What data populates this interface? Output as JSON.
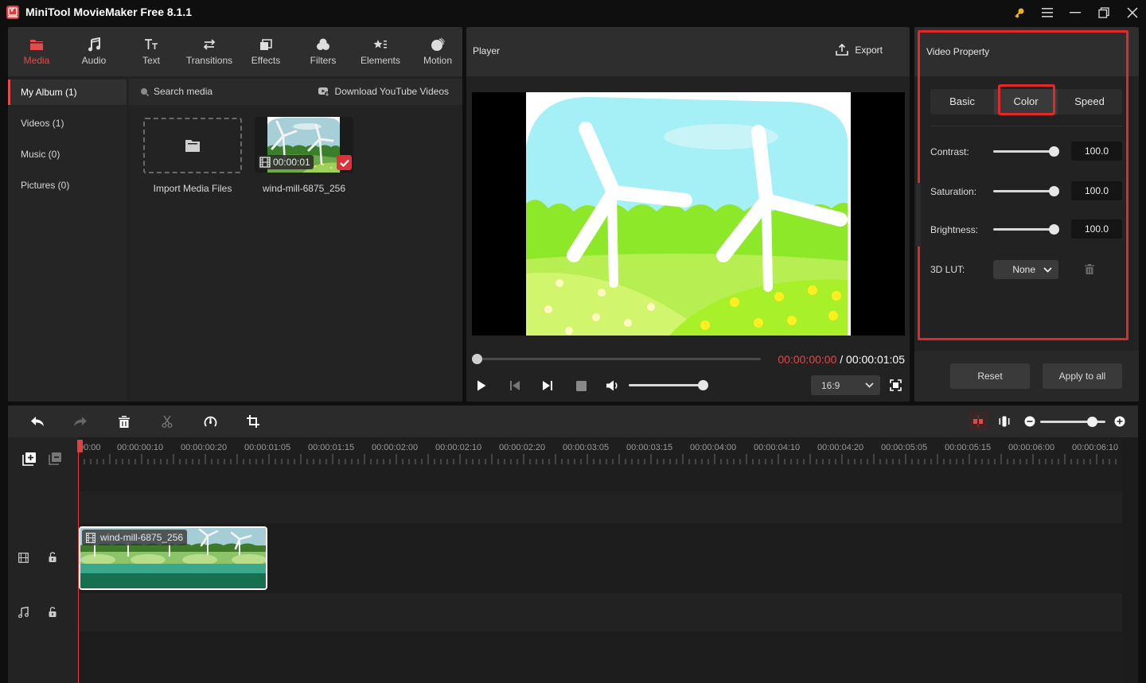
{
  "app": {
    "title": "MiniTool MovieMaker Free 8.1.1",
    "window_controls": [
      "key-icon",
      "menu-icon",
      "minimize-icon",
      "restore-icon",
      "close-icon"
    ]
  },
  "media_tabs": [
    {
      "label": "Media",
      "icon": "folder-icon",
      "active": true
    },
    {
      "label": "Audio",
      "icon": "music-note-icon",
      "active": false
    },
    {
      "label": "Text",
      "icon": "text-icon",
      "active": false
    },
    {
      "label": "Transitions",
      "icon": "transitions-icon",
      "active": false
    },
    {
      "label": "Effects",
      "icon": "effects-icon",
      "active": false
    },
    {
      "label": "Filters",
      "icon": "filters-icon",
      "active": false
    },
    {
      "label": "Elements",
      "icon": "elements-icon",
      "active": false
    },
    {
      "label": "Motion",
      "icon": "motion-icon",
      "active": false
    }
  ],
  "album": {
    "items": [
      {
        "label": "My Album (1)",
        "active": true
      },
      {
        "label": "Videos (1)",
        "active": false
      },
      {
        "label": "Music (0)",
        "active": false
      },
      {
        "label": "Pictures (0)",
        "active": false
      }
    ]
  },
  "media_library": {
    "search_placeholder": "Search media",
    "download_label": "Download YouTube Videos",
    "import_label": "Import Media Files",
    "items": [
      {
        "name": "wind-mill-6875_256",
        "duration": "00:00:01",
        "selected": true
      }
    ]
  },
  "player": {
    "title": "Player",
    "export_label": "Export",
    "current_time": "00:00:00:00",
    "separator": " / ",
    "total_time": "00:00:01:05",
    "progress": 0,
    "volume": 1.0,
    "aspect_ratio": "16:9"
  },
  "video_property": {
    "title": "Video Property",
    "tabs": [
      {
        "label": "Basic",
        "active": false
      },
      {
        "label": "Color",
        "active": true
      },
      {
        "label": "Speed",
        "active": false
      }
    ],
    "contrast": {
      "label": "Contrast:",
      "value": "100.0"
    },
    "saturation": {
      "label": "Saturation:",
      "value": "100.0"
    },
    "brightness": {
      "label": "Brightness:",
      "value": "100.0"
    },
    "lut": {
      "label": "3D LUT:",
      "value": "None"
    },
    "reset_label": "Reset",
    "apply_all_label": "Apply to all"
  },
  "timeline": {
    "ruler_labels": [
      "00:00",
      "00:00:00:10",
      "00:00:00:20",
      "00:00:01:05",
      "00:00:01:15",
      "00:00:02:00",
      "00:00:02:10",
      "00:00:02:20",
      "00:00:03:05",
      "00:00:03:15",
      "00:00:04:00",
      "00:00:04:10",
      "00:00:04:20",
      "00:00:05:05",
      "00:00:05:15",
      "00:00:06:00",
      "00:00:06:10"
    ],
    "clip": {
      "name": "wind-mill-6875_256"
    },
    "zoom_level": 0.8
  },
  "colors": {
    "accent": "#e44b4b",
    "highlight_box": "#e02a2a",
    "time_current": "#e04848",
    "clip_teal": "#1a7050"
  }
}
